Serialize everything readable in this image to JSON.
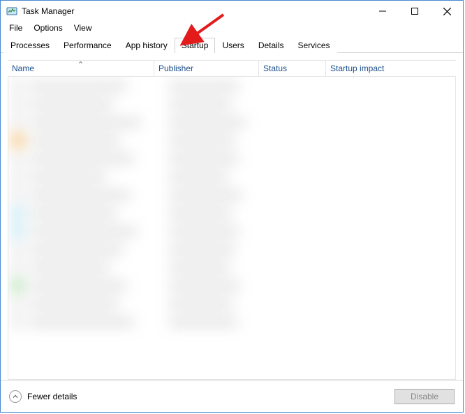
{
  "window": {
    "title": "Task Manager"
  },
  "menubar": {
    "items": [
      "File",
      "Options",
      "View"
    ]
  },
  "tabs": {
    "items": [
      "Processes",
      "Performance",
      "App history",
      "Startup",
      "Users",
      "Details",
      "Services"
    ],
    "active_index": 3
  },
  "columns": {
    "name": "Name",
    "publisher": "Publisher",
    "status": "Status",
    "impact": "Startup impact",
    "sort_column": "name",
    "sort_dir": "asc"
  },
  "footer": {
    "fewer_details": "Fewer details",
    "disable": "Disable"
  },
  "annotation": {
    "arrow_points_to_tab": "Startup"
  }
}
